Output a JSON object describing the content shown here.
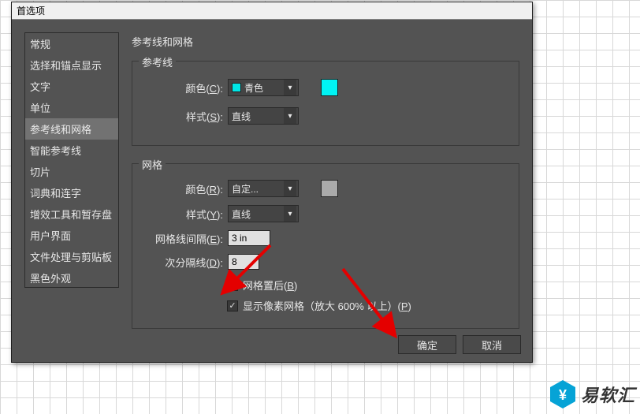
{
  "dialog": {
    "title": "首选项"
  },
  "sidebar": {
    "items": [
      "常规",
      "选择和锚点显示",
      "文字",
      "单位",
      "参考线和网格",
      "智能参考线",
      "切片",
      "词典和连字",
      "增效工具和暂存盘",
      "用户界面",
      "文件处理与剪贴板",
      "黑色外观"
    ],
    "selected_index": 4
  },
  "panel": {
    "title": "参考线和网格"
  },
  "guides_group": {
    "legend": "参考线",
    "color_label_pre": "颜色(",
    "color_hotkey": "C",
    "color_label_post": "):",
    "color_value": "青色",
    "color_swatch": "#00f4f4",
    "style_label_pre": "样式(",
    "style_hotkey": "S",
    "style_label_post": "):",
    "style_value": "直线"
  },
  "grid_group": {
    "legend": "网格",
    "color_label_pre": "颜色(",
    "color_hotkey": "R",
    "color_label_post": "):",
    "color_value": "自定...",
    "color_swatch": "#aaaaaa",
    "style_label_pre": "样式(",
    "style_hotkey": "Y",
    "style_label_post": "):",
    "style_value": "直线",
    "gap_label_pre": "网格线间隔(",
    "gap_hotkey": "E",
    "gap_label_post": "):",
    "gap_value": "3 in",
    "subdiv_label_pre": "次分隔线(",
    "subdiv_hotkey": "D",
    "subdiv_label_post": "):",
    "subdiv_value": "8",
    "grid_back_pre": "网格置后(",
    "grid_back_hotkey": "B",
    "grid_back_post": ")",
    "pixel_grid_pre": "显示像素网格（放大 600% 以上）(",
    "pixel_grid_hotkey": "P",
    "pixel_grid_post": ")"
  },
  "buttons": {
    "ok": "确定",
    "cancel": "取消"
  },
  "brand": {
    "text": "易软汇"
  }
}
